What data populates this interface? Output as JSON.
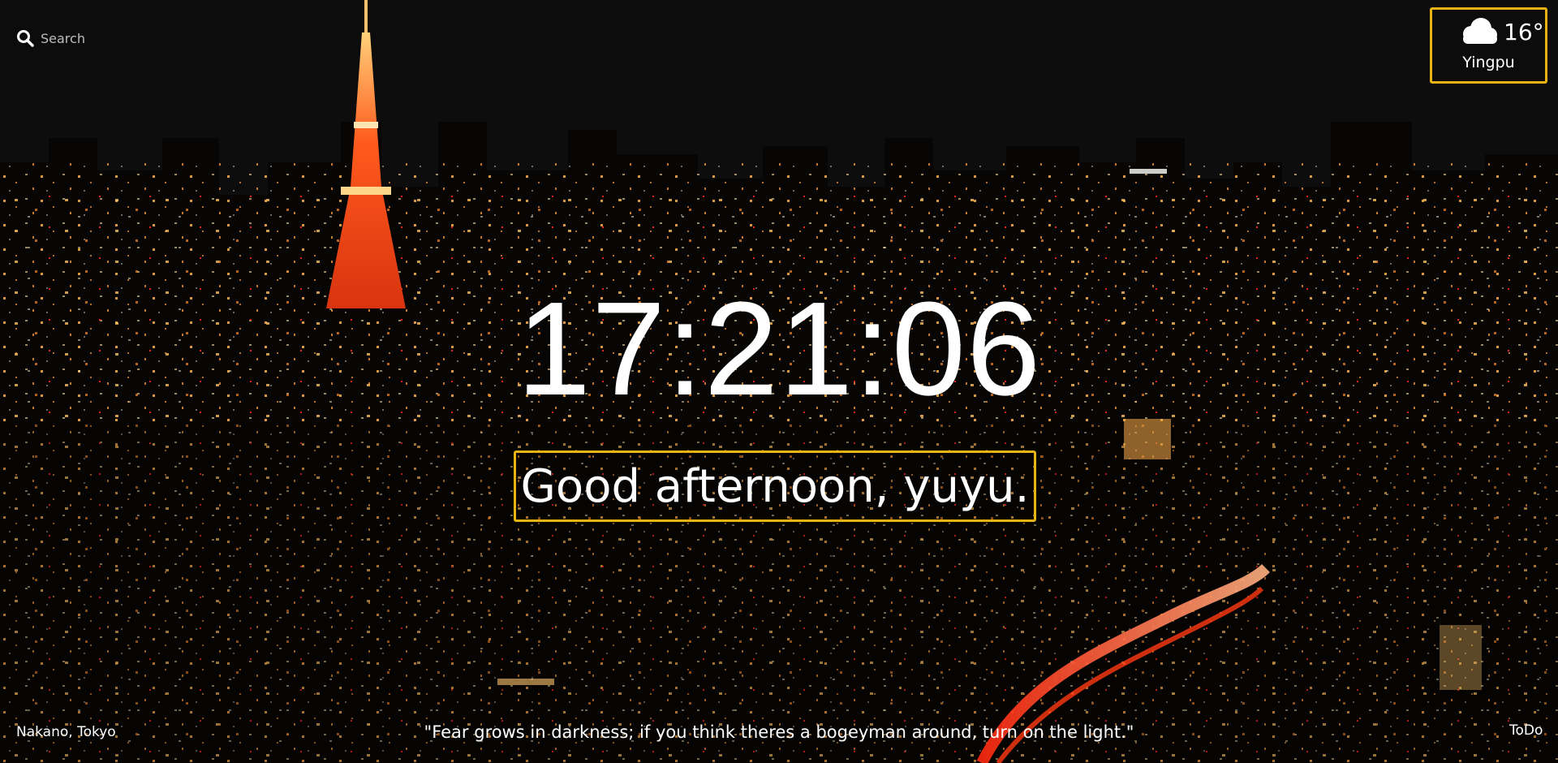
{
  "search": {
    "placeholder": "Search",
    "icon": "search-icon"
  },
  "weather": {
    "icon": "cloud-icon",
    "temperature": "16°",
    "location": "Yingpu"
  },
  "clock": {
    "time": "17:21:06"
  },
  "greeting": {
    "text": "Good afternoon, yuyu."
  },
  "footer": {
    "photo_location": "Nakano, Tokyo",
    "quote": "\"Fear grows in darkness; if you think theres a bogeyman around, turn on the light.\"",
    "todo_label": "ToDo"
  },
  "colors": {
    "highlight_border": "#e9b311",
    "text": "#ffffff"
  }
}
